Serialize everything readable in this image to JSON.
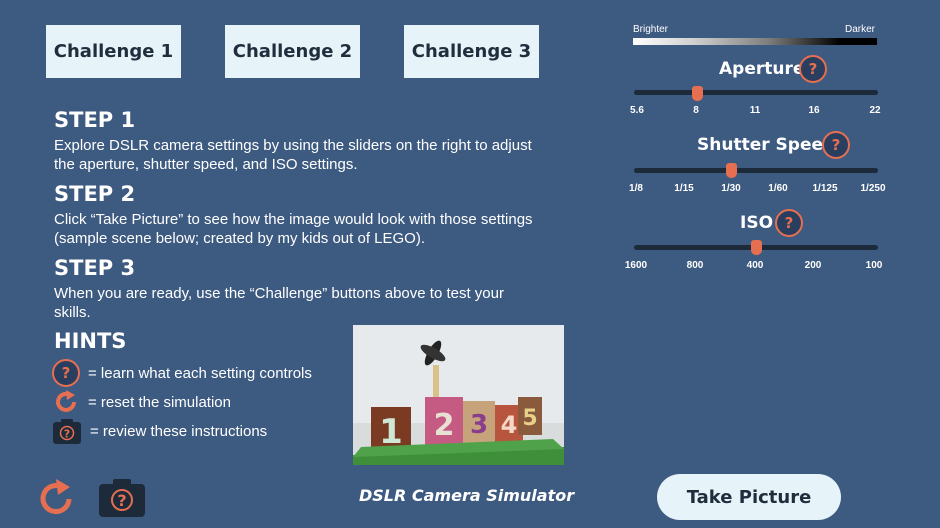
{
  "challenges": [
    "Challenge 1",
    "Challenge 2",
    "Challenge 3"
  ],
  "steps": [
    {
      "title": "STEP 1",
      "text": "Explore DSLR camera settings by using the sliders on the right to adjust the aperture, shutter speed, and ISO settings."
    },
    {
      "title": "STEP 2",
      "text": "Click “Take Picture” to see how the image would look with those settings (sample scene below; created by my kids out of LEGO)."
    },
    {
      "title": "STEP 3",
      "text": "When you are ready, use the “Challenge” buttons above to test your skills."
    }
  ],
  "hints": {
    "title": "HINTS",
    "items": [
      {
        "icon": "question-icon",
        "text": "= learn what each setting controls"
      },
      {
        "icon": "reset-icon",
        "text": "= reset the simulation"
      },
      {
        "icon": "camera-help-icon",
        "text": "= review these instructions"
      }
    ]
  },
  "help_glyph": "?",
  "app_title": "DSLR Camera Simulator",
  "take_picture": "Take Picture",
  "exposure": {
    "brighter": "Brighter",
    "darker": "Darker"
  },
  "sliders": {
    "aperture": {
      "label": "Aperture",
      "ticks": [
        "5.6",
        "8",
        "11",
        "16",
        "22"
      ],
      "value": "8",
      "thumb_fraction": 0.26
    },
    "shutter": {
      "label": "Shutter Speed",
      "ticks": [
        "1/8",
        "1/15",
        "1/30",
        "1/60",
        "1/125",
        "1/250"
      ],
      "value": "1/30",
      "thumb_fraction": 0.4
    },
    "iso": {
      "label": "ISO",
      "ticks": [
        "1600",
        "800",
        "400",
        "200",
        "100"
      ],
      "value": "400",
      "thumb_fraction": 0.5
    }
  },
  "colors": {
    "background": "#3d5a80",
    "accent": "#e76f51",
    "button": "#e6f3f8"
  }
}
